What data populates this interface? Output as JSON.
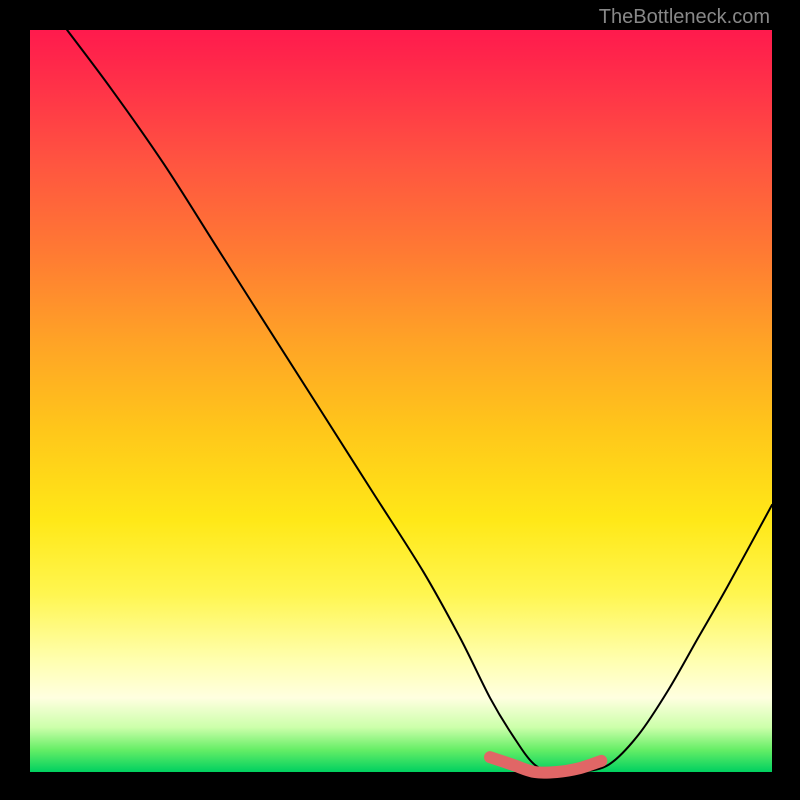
{
  "watermark": "TheBottleneck.com",
  "chart_data": {
    "type": "line",
    "title": "",
    "xlabel": "",
    "ylabel": "",
    "xlim": [
      0,
      100
    ],
    "ylim": [
      0,
      100
    ],
    "series": [
      {
        "name": "bottleneck-curve",
        "x": [
          5,
          11,
          18,
          25,
          32,
          39,
          46,
          53,
          58,
          62,
          65,
          68,
          71,
          74,
          78,
          82,
          86,
          90,
          94,
          100
        ],
        "values": [
          100,
          92,
          82,
          71,
          60,
          49,
          38,
          27,
          18,
          10,
          5,
          1,
          0,
          0,
          1,
          5,
          11,
          18,
          25,
          36
        ]
      },
      {
        "name": "optimal-segment",
        "x": [
          62,
          65,
          68,
          71,
          74,
          77
        ],
        "values": [
          2,
          1,
          0,
          0,
          0.5,
          1.5
        ]
      }
    ],
    "annotations": [],
    "grid": false,
    "background_gradient": [
      "#ff1a4d",
      "#ff7a33",
      "#ffe817",
      "#ffffe0",
      "#00d060"
    ]
  }
}
